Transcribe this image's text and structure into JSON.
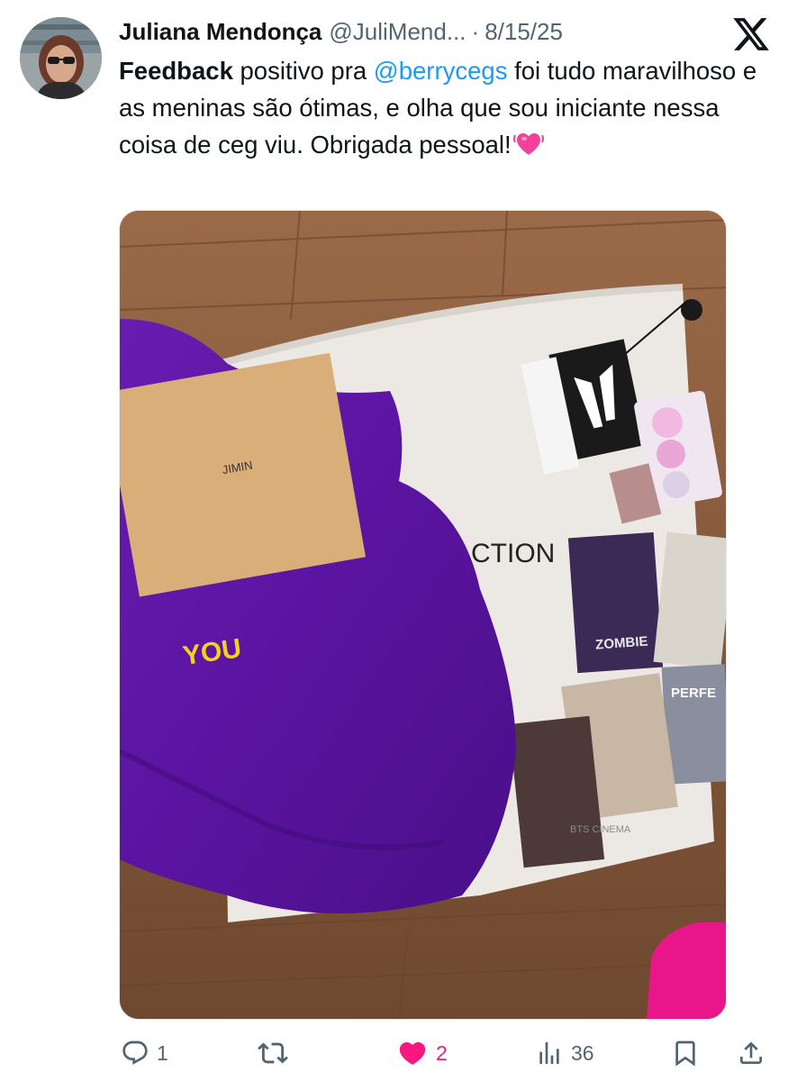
{
  "tweet": {
    "author": {
      "display_name": "Juliana Mendonça",
      "handle": "@JuliMend...",
      "separator": "·",
      "date": "8/15/25"
    },
    "text": {
      "bold_word": "Feedback",
      "part1": " positivo pra ",
      "mention": "@berrycegs",
      "part2": " foi tudo maravilhoso e as meninas são ótimas, e olha que sou iniciante nessa coisa de ceg viu. Obrigada pessoal!",
      "emoji": "heart-with-ribbon-emoji"
    },
    "media": {
      "type": "photo",
      "photo_text": {
        "envelope_label": "JIMIN",
        "sweatshirt_print": "YOU",
        "bag_print": "CTION",
        "ticket_1": "ZOMBIE",
        "ticket_2": "PERFE",
        "ticket_3": "BTS CINEMA"
      }
    },
    "actions": {
      "reply": {
        "icon": "reply-icon",
        "count": "1"
      },
      "retweet": {
        "icon": "retweet-icon",
        "count": ""
      },
      "like": {
        "icon": "heart-filled-icon",
        "count": "2",
        "liked": true
      },
      "views": {
        "icon": "views-icon",
        "count": "36"
      },
      "bookmark": {
        "icon": "bookmark-icon"
      },
      "share": {
        "icon": "share-icon"
      }
    },
    "colors": {
      "text": "#0f1419",
      "secondary": "#536471",
      "link": "#1d9bf0",
      "like": "#f91880"
    }
  }
}
